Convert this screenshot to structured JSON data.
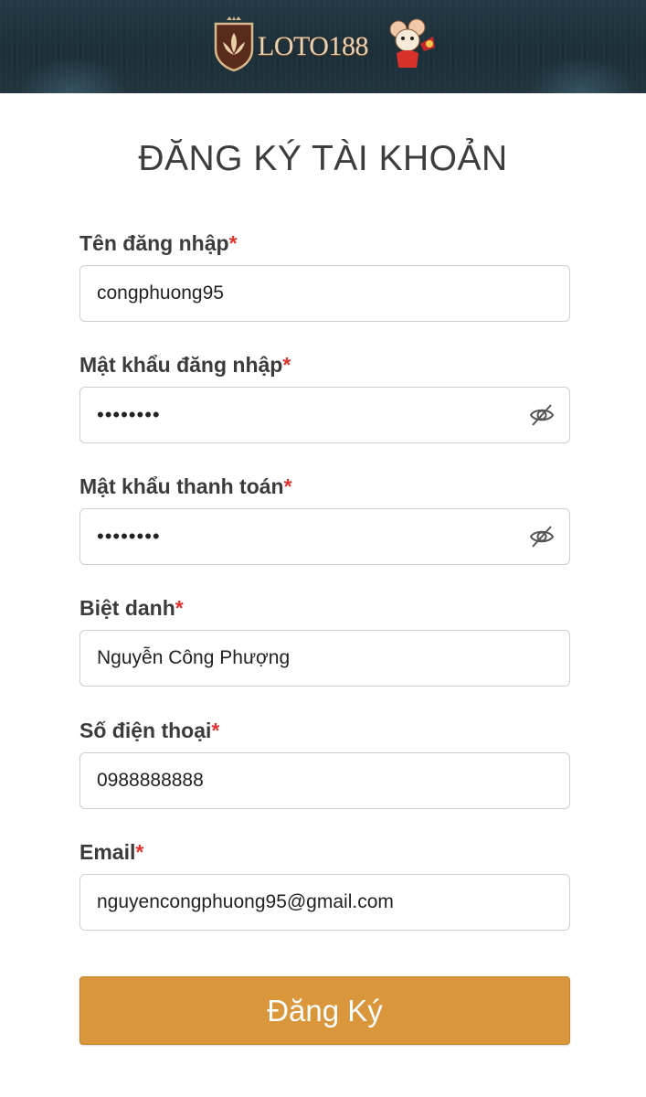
{
  "brand": {
    "logo_text": "LOTO188"
  },
  "page": {
    "title": "ĐĂNG KÝ TÀI KHOẢN"
  },
  "required_mark": "*",
  "form": {
    "username": {
      "label": "Tên đăng nhập",
      "value": "congphuong95"
    },
    "password": {
      "label": "Mật khẩu đăng nhập",
      "value": "••••••••"
    },
    "payment_password": {
      "label": "Mật khẩu thanh toán",
      "value": "••••••••"
    },
    "nickname": {
      "label": "Biệt danh",
      "value": "Nguyễn Công Phượng"
    },
    "phone": {
      "label": "Số điện thoại",
      "value": "0988888888"
    },
    "email": {
      "label": "Email",
      "value": "nguyencongphuong95@gmail.com"
    }
  },
  "submit": {
    "label": "Đăng Ký"
  },
  "colors": {
    "accent": "#d9963a",
    "required": "#e0332e",
    "header_bg": "#1c2f38"
  },
  "icons": [
    "lotus-shield-logo-icon",
    "mouse-mascot-icon",
    "eye-slash-icon"
  ]
}
